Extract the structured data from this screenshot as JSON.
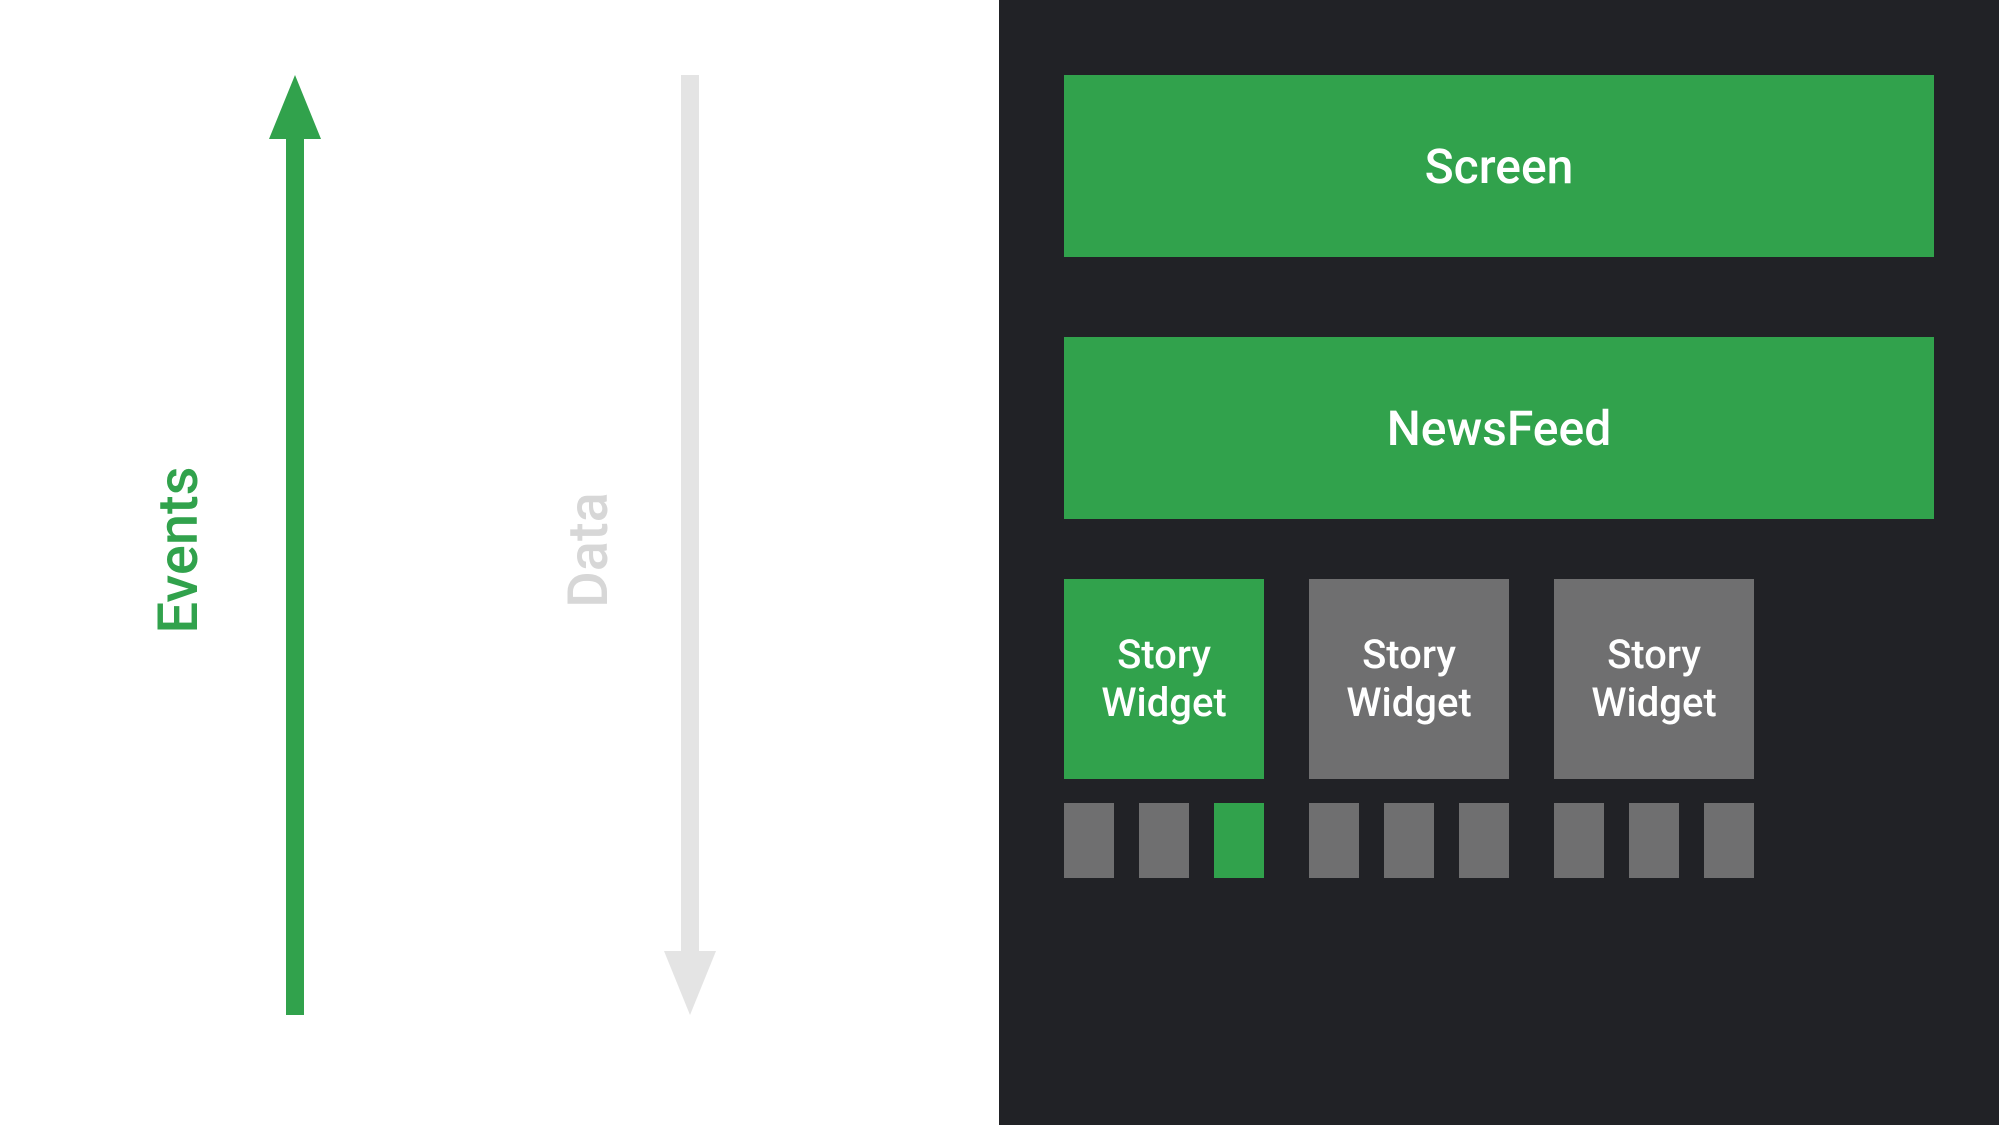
{
  "arrows": {
    "events": {
      "label": "Events",
      "color": "#31a24c"
    },
    "data": {
      "label": "Data",
      "color": "#d7d7d7"
    }
  },
  "hierarchy": {
    "screen": {
      "label": "Screen",
      "active": true
    },
    "newsfeed": {
      "label": "NewsFeed",
      "active": true
    },
    "widgets": [
      {
        "label": "Story\nWidget",
        "active": true,
        "children": [
          {
            "active": false
          },
          {
            "active": false
          },
          {
            "active": true
          }
        ]
      },
      {
        "label": "Story\nWidget",
        "active": false,
        "children": [
          {
            "active": false
          },
          {
            "active": false
          },
          {
            "active": false
          }
        ]
      },
      {
        "label": "Story\nWidget",
        "active": false,
        "children": [
          {
            "active": false
          },
          {
            "active": false
          },
          {
            "active": false
          }
        ]
      }
    ]
  },
  "colors": {
    "green": "#31a24c",
    "grey": "#6f6f70",
    "lightGrey": "#d7d7d7",
    "dark": "#212226"
  }
}
